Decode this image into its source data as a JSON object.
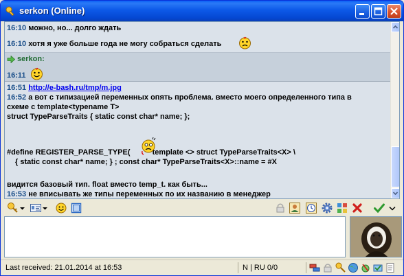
{
  "window": {
    "title": "serkon (Online)"
  },
  "log": {
    "block_a": [
      {
        "time": "16:10",
        "text": "можно, но... долго ждать"
      },
      {
        "time": "16:10",
        "text": "хотя я уже больше года не могу собраться сделать"
      }
    ],
    "block_b": {
      "nick": "serkon:",
      "time": "16:11"
    },
    "block_c": {
      "l1_time": "16:51",
      "l1_link": "http://e-bash.ru/tmp/m.jpg",
      "l2_time": "16:52",
      "l2_text": "а вот с типизацией переменных опять проблема. вместо моего определенного типа в",
      "l3_text": "схеме с template<typename T>",
      "l4_text": "struct TypeParseTraits { static const char* name; };",
      "l5_text_a": "#define REGISTER_PARSE_TYPE(",
      "l5_text_b": "template <> struct TypeParseTraits<X> \\",
      "l6_text": "{ static const char* name; } ; const char* TypeParseTraits<X>::name = #X",
      "l7_text": "видится базовый тип. float вместо temp_t. как быть...",
      "l8_time": "16:53",
      "l8_text": "не вписывать же типы переменных по их названию в менеджер"
    }
  },
  "input": {
    "value": ""
  },
  "status": {
    "last_received": "Last received: 21.01.2014 at 16:53",
    "mode": "N | RU 0/0"
  },
  "colors": {
    "titlebar": "#0a5ff5",
    "timestamp": "#1b4f8a",
    "link": "#0000ee",
    "nick": "#1f6b32"
  },
  "icons": {
    "toolbar_left": [
      "key-icon",
      "chevron-down-icon",
      "contact-card-icon",
      "chevron-down-icon",
      "smiley-icon",
      "history-icon"
    ],
    "toolbar_right": [
      "lock-icon",
      "user-info-icon",
      "clock-icon",
      "gear-icon",
      "block-icon",
      "close-icon",
      "send-check-icon",
      "chevron-down-icon"
    ],
    "status": [
      "network-icon",
      "lock-icon",
      "key-icon",
      "globe-icon",
      "plugin-icon",
      "plugin-icon",
      "notes-icon"
    ]
  }
}
